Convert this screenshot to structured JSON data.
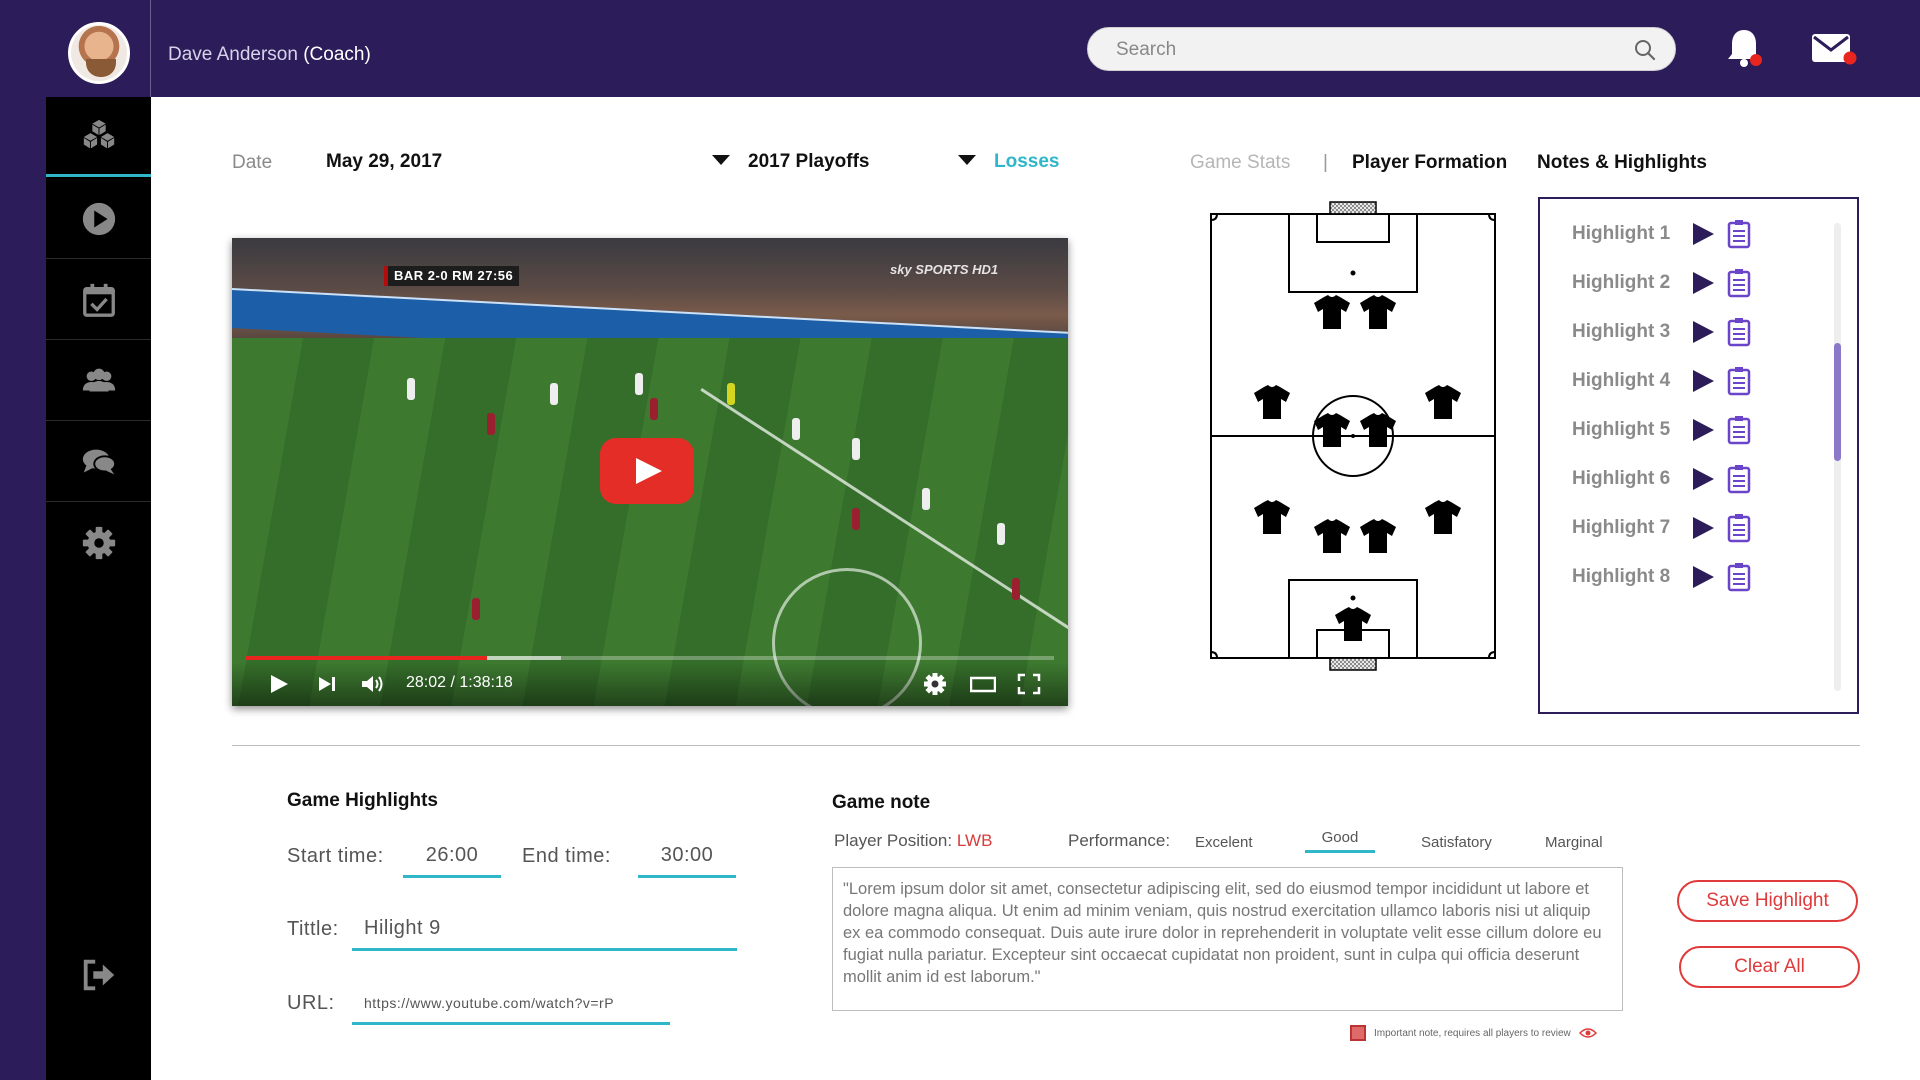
{
  "header": {
    "user_name": "Dave Anderson",
    "user_role": "(Coach)",
    "search_placeholder": "Search",
    "notifications_badge_color": "#e8251f",
    "accent_color": "#2c1c59"
  },
  "sidebar": {
    "items": [
      {
        "icon": "cubes-icon",
        "active": true
      },
      {
        "icon": "play-icon"
      },
      {
        "icon": "calendar-check-icon"
      },
      {
        "icon": "users-icon"
      },
      {
        "icon": "chat-icon"
      },
      {
        "icon": "gear-icon"
      }
    ],
    "logout_icon": "logout-icon"
  },
  "filters": {
    "date_label": "Date",
    "date_value": "May 29, 2017",
    "season": "2017 Playoffs",
    "result": "Losses"
  },
  "tabs": {
    "game_stats": "Game Stats",
    "separator": "|",
    "player_formation": "Player Formation",
    "notes_highlights": "Notes & Highlights"
  },
  "video": {
    "scoreboard": "BAR 2-0 RM 27:56",
    "channel": "sky SPORTS HD1",
    "current_time": "28:02",
    "duration": "1:38:18",
    "time_display": "28:02 / 1:38:18",
    "progress_fraction": 0.2985
  },
  "highlights": [
    {
      "label": "Highlight 1"
    },
    {
      "label": "Highlight 2"
    },
    {
      "label": "Highlight 3"
    },
    {
      "label": "Highlight 4"
    },
    {
      "label": "Highlight 5"
    },
    {
      "label": "Highlight 6"
    },
    {
      "label": "Highlight 7"
    },
    {
      "label": "Highlight 8"
    }
  ],
  "game_highlights": {
    "title": "Game Highlights",
    "start_label": "Start time:",
    "start_value": "26:00",
    "end_label": "End time:",
    "end_value": "30:00",
    "title_label": "Tittle:",
    "title_value": "Hilight 9",
    "url_label": "URL:",
    "url_value": "https://www.youtube.com/watch?v=rP"
  },
  "game_note": {
    "title": "Game note",
    "position_label": "Player Position:",
    "position_value": "LWB",
    "performance_label": "Performance:",
    "performance_options": [
      "Excelent",
      "Good",
      "Satisfatory",
      "Marginal"
    ],
    "performance_selected": "Good",
    "note_text": "\"Lorem ipsum dolor sit amet, consectetur adipiscing elit, sed do eiusmod tempor incididunt ut labore et dolore magna aliqua. Ut enim ad minim veniam, quis nostrud exercitation ullamco laboris nisi ut aliquip ex ea commodo consequat. Duis aute irure dolor in reprehenderit in voluptate velit esse cillum dolore eu fugiat nulla pariatur. Excepteur sint occaecat cupidatat non proident, sunt in culpa qui officia deserunt mollit anim id est laborum.\"",
    "important_label": "Important note, requires all players to review",
    "important_checked": true
  },
  "actions": {
    "save": "Save Highlight",
    "clear": "Clear All"
  }
}
